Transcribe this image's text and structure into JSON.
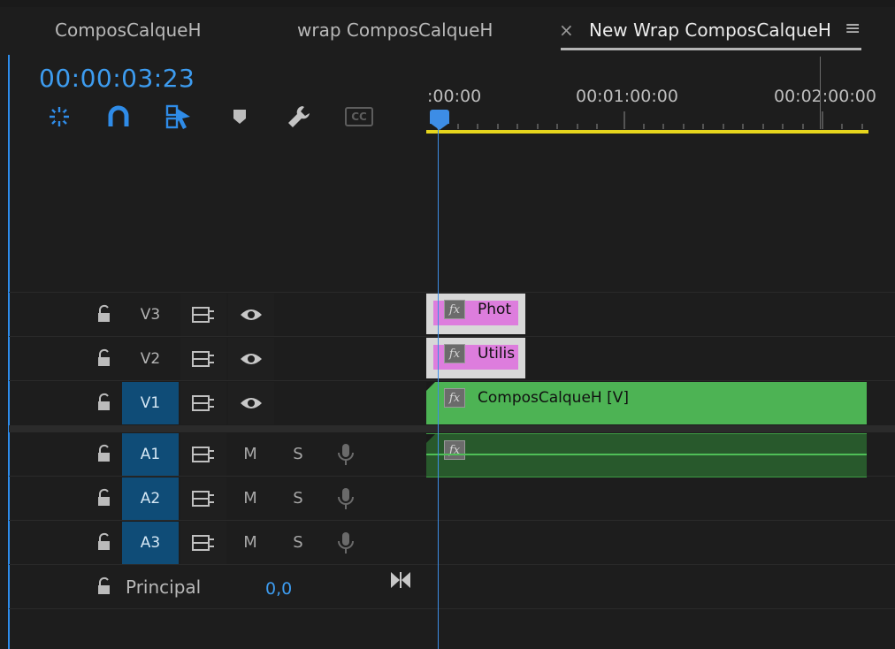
{
  "tabs": [
    {
      "label": "ComposCalqueH"
    },
    {
      "label": "wrap ComposCalqueH"
    },
    {
      "label": "New Wrap ComposCalqueH",
      "close_glyph": "×",
      "menu_glyph": "≡",
      "active": true
    }
  ],
  "timeline": {
    "timecode": "00:00:03:23",
    "ruler": [
      ":00:00",
      "00:01:00:00",
      "00:02:00:00"
    ],
    "tools": [
      "insert-sequence-nest-icon",
      "snap-magnet-icon",
      "linked-selection-icon",
      "add-marker-icon",
      "wrench-settings-icon",
      "captions-icon"
    ],
    "captions_label": "CC"
  },
  "tracks": {
    "video": [
      {
        "name": "V3",
        "targeted": false
      },
      {
        "name": "V2",
        "targeted": false
      },
      {
        "name": "V1",
        "targeted": true
      }
    ],
    "audio": [
      {
        "name": "A1",
        "mute": "M",
        "solo": "S"
      },
      {
        "name": "A2",
        "mute": "M",
        "solo": "S"
      },
      {
        "name": "A3",
        "mute": "M",
        "solo": "S"
      }
    ],
    "master": {
      "name": "Principal",
      "value": "0,0"
    }
  },
  "clips": {
    "v3": {
      "label": "Phot",
      "fx": "fx"
    },
    "v2": {
      "label": "Utilis",
      "fx": "fx"
    },
    "v1": {
      "label": "ComposCalqueH [V]",
      "fx": "fx"
    },
    "a1": {
      "fx": "fx"
    }
  },
  "colors": {
    "accent": "#3d9cf0",
    "target": "#0f4c77",
    "video_clip": "#4db354",
    "audio_clip": "#28592c",
    "graphic_clip": "#dd7ddd",
    "inout_bar": "#e6d51d"
  }
}
